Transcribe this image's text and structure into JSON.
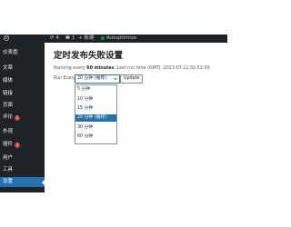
{
  "admin_bar": {
    "updates_count": "4",
    "comments_count": "1",
    "new_label": "+ 新建",
    "performance_label": "Autoptimize"
  },
  "sidebar": {
    "items": [
      {
        "label": "仪表盘",
        "badge": ""
      },
      {
        "label": "文章",
        "badge": ""
      },
      {
        "label": "媒体",
        "badge": ""
      },
      {
        "label": "链接",
        "badge": ""
      },
      {
        "label": "页面",
        "badge": ""
      },
      {
        "label": "评论",
        "badge": "1"
      },
      {
        "label": "外观",
        "badge": ""
      },
      {
        "label": "插件",
        "badge": "3"
      },
      {
        "label": "用户",
        "badge": ""
      },
      {
        "label": "工具",
        "badge": ""
      },
      {
        "label": "设置",
        "badge": ""
      }
    ],
    "active_index": 10
  },
  "page": {
    "title": "定时发布失败设置",
    "running_prefix": "Running every ",
    "running_interval": "60 minutes",
    "running_suffix": ". Last run time (GMT): 2023-07-11 02:52:00",
    "run_every_label": "Run Every",
    "selected_value": "20 分钟 (推荐)",
    "update_label": "Update",
    "options": [
      "5 分钟",
      "10 分钟",
      "15 分钟",
      "20 分钟 (推荐)",
      "30 分钟",
      "60 分钟"
    ],
    "selected_index": 3
  },
  "colors": {
    "sidebar_bg": "#1d2327",
    "accent": "#2271b1",
    "badge": "#d63638"
  }
}
